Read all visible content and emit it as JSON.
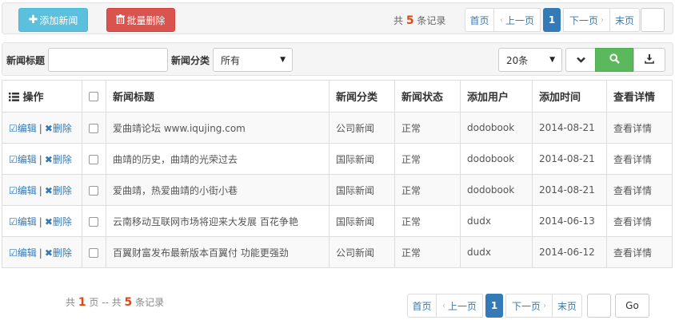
{
  "toolbar": {
    "add_label": "添加新闻",
    "add_icon": "plus-icon",
    "batch_delete_label": "批量删除",
    "batch_delete_icon": "trash-icon"
  },
  "pagination_top": {
    "total_prefix": "共",
    "total_count": "5",
    "total_suffix": "条记录",
    "first": "首页",
    "prev": "上一页",
    "current": "1",
    "next": "下一页",
    "last": "末页"
  },
  "filters": {
    "title_label": "新闻标题",
    "title_value": "",
    "category_label": "新闻分类",
    "category_selected": "所有",
    "page_size_selected": "20条"
  },
  "table": {
    "headers": {
      "operation": "操作",
      "title": "新闻标题",
      "category": "新闻分类",
      "status": "新闻状态",
      "user": "添加用户",
      "time": "添加时间",
      "detail": "查看详情"
    },
    "edit_label": "编辑",
    "delete_label": "删除",
    "rows": [
      {
        "title": "爱曲靖论坛 www.iqujing.com",
        "category": "公司新闻",
        "status": "正常",
        "user": "dodobook",
        "time": "2014-08-21",
        "detail": "查看详情"
      },
      {
        "title": "曲靖的历史，曲靖的光荣过去",
        "category": "国际新闻",
        "status": "正常",
        "user": "dodobook",
        "time": "2014-08-21",
        "detail": "查看详情"
      },
      {
        "title": "爱曲靖，热爱曲靖的小街小巷",
        "category": "国际新闻",
        "status": "正常",
        "user": "dodobook",
        "time": "2014-08-21",
        "detail": "查看详情"
      },
      {
        "title": "云南移动互联网市场将迎来大发展 百花争艳",
        "category": "国际新闻",
        "status": "正常",
        "user": "dudx",
        "time": "2014-06-13",
        "detail": "查看详情"
      },
      {
        "title": "百翼财富发布最新版本百翼付 功能更强劲",
        "category": "公司新闻",
        "status": "正常",
        "user": "dudx",
        "time": "2014-06-12",
        "detail": "查看详情"
      }
    ]
  },
  "pagination_bottom": {
    "pages_prefix": "共",
    "pages_count": "1",
    "pages_suffix": "页 -- 共",
    "records_count": "5",
    "records_suffix": "条记录",
    "first": "首页",
    "prev": "上一页",
    "current": "1",
    "next": "下一页",
    "last": "末页",
    "go": "Go"
  },
  "colors": {
    "info": "#5bc0de",
    "danger": "#d9534f",
    "success": "#5cb85c",
    "primary": "#337ab7",
    "status_ok": "#2e9c1e",
    "count_red": "#e8440f"
  }
}
